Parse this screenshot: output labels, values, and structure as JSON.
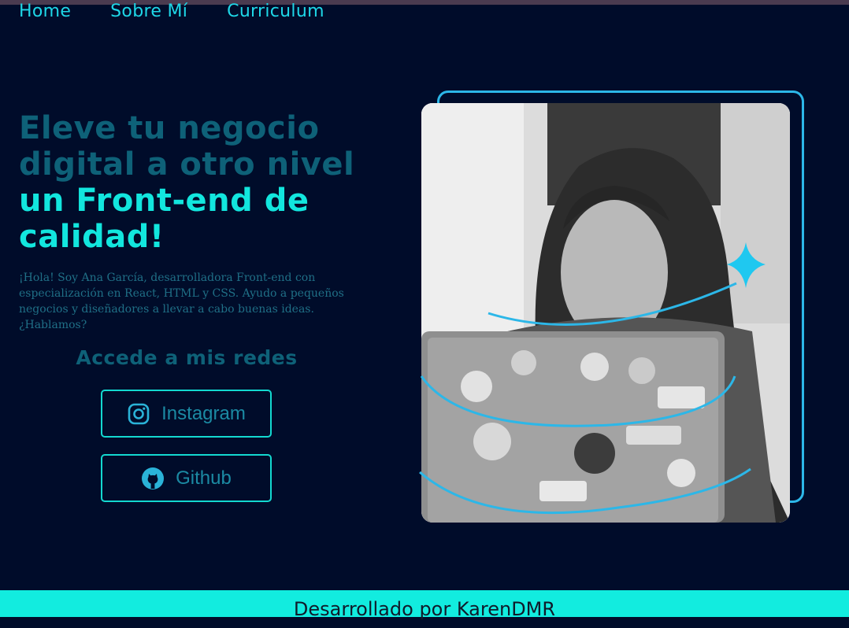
{
  "nav": {
    "items": [
      {
        "label": "Home"
      },
      {
        "label": "Sobre Mí"
      },
      {
        "label": "Curriculum"
      }
    ]
  },
  "hero": {
    "title_line1": "Eleve tu negocio",
    "title_line2": "digital a otro nivel",
    "title_line3": "un Front-end de",
    "title_line4": "calidad!",
    "intro": "¡Hola! Soy Ana García, desarrolladora Front-end con especialización en React, HTML y CSS. Ayudo a pequeños negocios y diseñadores a llevar a cabo buenas ideas. ¿Hablamos?"
  },
  "social": {
    "title": "Accede a mis redes",
    "instagram_label": "Instagram",
    "github_label": "Github",
    "instagram_icon": "instagram-icon",
    "github_icon": "github-icon"
  },
  "footer": {
    "text": "Desarrollado por KarenDMR"
  },
  "colors": {
    "background": "#000c2a",
    "accent": "#12e6de",
    "muted_title": "#0e6178",
    "frame": "#2cb7e8"
  }
}
